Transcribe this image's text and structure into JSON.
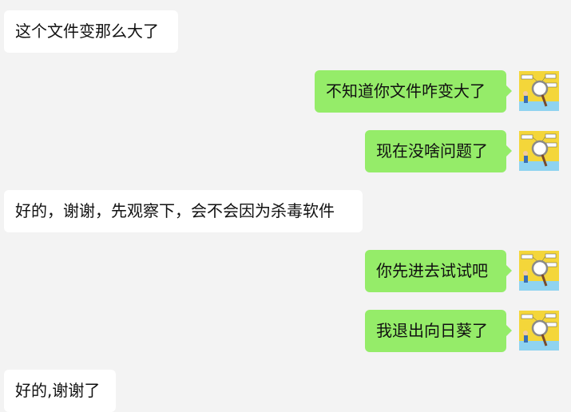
{
  "conversation": {
    "messages": [
      {
        "side": "in",
        "text": "这个文件变那么大了"
      },
      {
        "side": "out",
        "text": "不知道你文件咋变大了",
        "avatar": "sender-avatar"
      },
      {
        "side": "out",
        "text": "现在没啥问题了",
        "avatar": "sender-avatar"
      },
      {
        "side": "in",
        "text": "好的，谢谢，先观察下，会不会因为杀毒软件"
      },
      {
        "side": "out",
        "text": "你先进去试试吧",
        "avatar": "sender-avatar"
      },
      {
        "side": "out",
        "text": "我退出向日葵了",
        "avatar": "sender-avatar"
      },
      {
        "side": "in",
        "text": "好的,谢谢了"
      }
    ]
  },
  "colors": {
    "background": "#f3f3f3",
    "incoming_bubble": "#ffffff",
    "outgoing_bubble": "#95ec69",
    "text": "#111111"
  }
}
